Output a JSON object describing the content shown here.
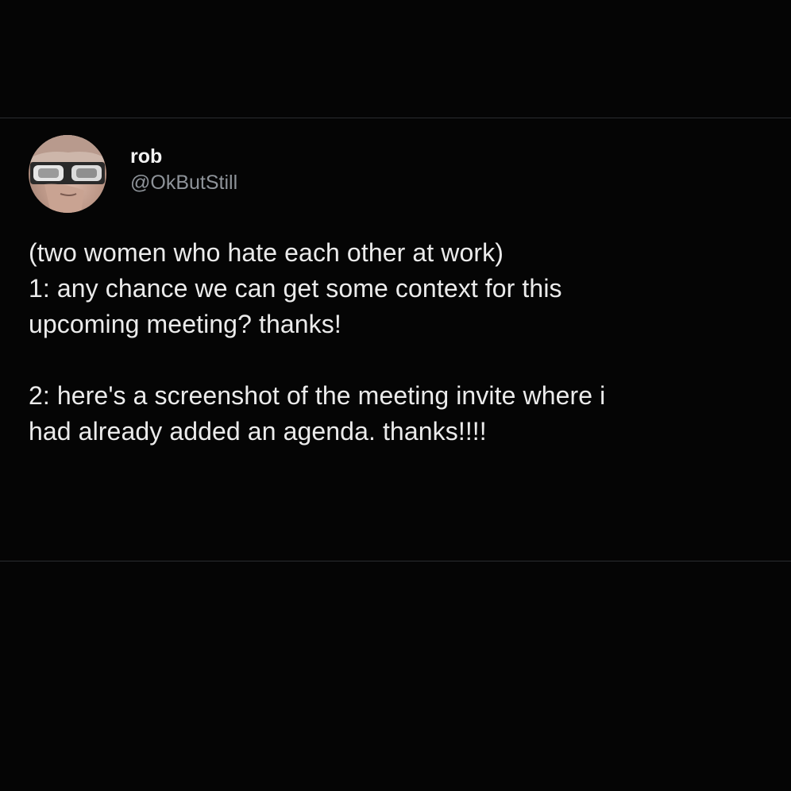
{
  "tweet": {
    "display_name": "rob",
    "handle": "@OkButStill",
    "avatar_icon": "profile-photo-sunglasses",
    "lines": [
      "(two women who hate each other at work)",
      "1: any chance we can get some context for this",
      "upcoming meeting? thanks!",
      "",
      "2: here's a screenshot of the meeting invite where i",
      "had already added an agenda. thanks!!!!"
    ]
  }
}
